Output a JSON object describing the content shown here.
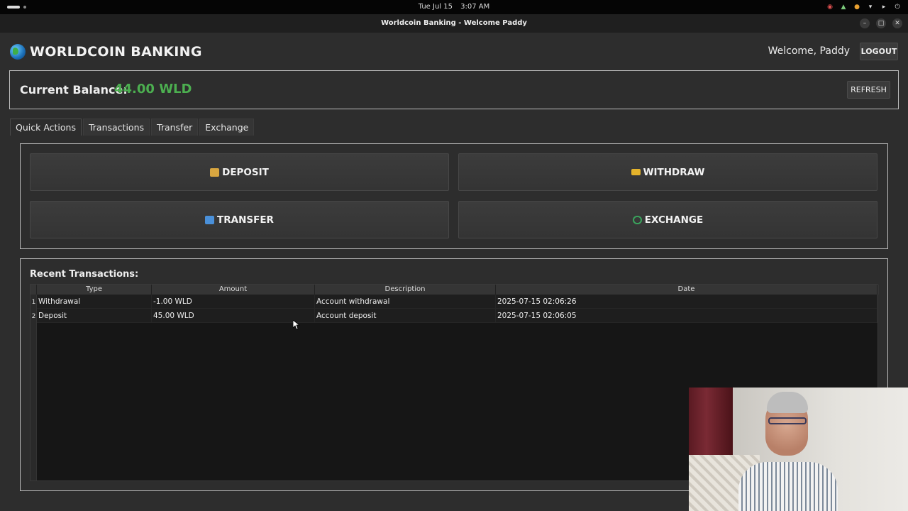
{
  "system": {
    "date": "Tue Jul 15",
    "time": "3:07 AM"
  },
  "window": {
    "title": "Worldcoin Banking - Welcome Paddy"
  },
  "header": {
    "brand": "WORLDCOIN BANKING",
    "welcome": "Welcome, Paddy",
    "logout_label": "LOGOUT"
  },
  "balance": {
    "label": "Current Balance:",
    "value": "44.00 WLD",
    "value_color": "#4caf50",
    "refresh_label": "REFRESH"
  },
  "tabs": [
    {
      "label": "Quick Actions",
      "active": true
    },
    {
      "label": "Transactions",
      "active": false
    },
    {
      "label": "Transfer",
      "active": false
    },
    {
      "label": "Exchange",
      "active": false
    }
  ],
  "quick_actions": [
    {
      "label": "DEPOSIT",
      "icon": "money-bag-icon"
    },
    {
      "label": "WITHDRAW",
      "icon": "credit-card-icon"
    },
    {
      "label": "TRANSFER",
      "icon": "swap-arrows-icon"
    },
    {
      "label": "EXCHANGE",
      "icon": "currency-exchange-icon"
    }
  ],
  "recent": {
    "title": "Recent Transactions:",
    "columns": [
      "Type",
      "Amount",
      "Description",
      "Date"
    ],
    "rows": [
      {
        "num": "1",
        "type": "Withdrawal",
        "amount": "-1.00 WLD",
        "description": "Account withdrawal",
        "date": "2025-07-15 02:06:26"
      },
      {
        "num": "2",
        "type": "Deposit",
        "amount": "45.00 WLD",
        "description": "Account deposit",
        "date": "2025-07-15 02:06:05"
      }
    ]
  }
}
